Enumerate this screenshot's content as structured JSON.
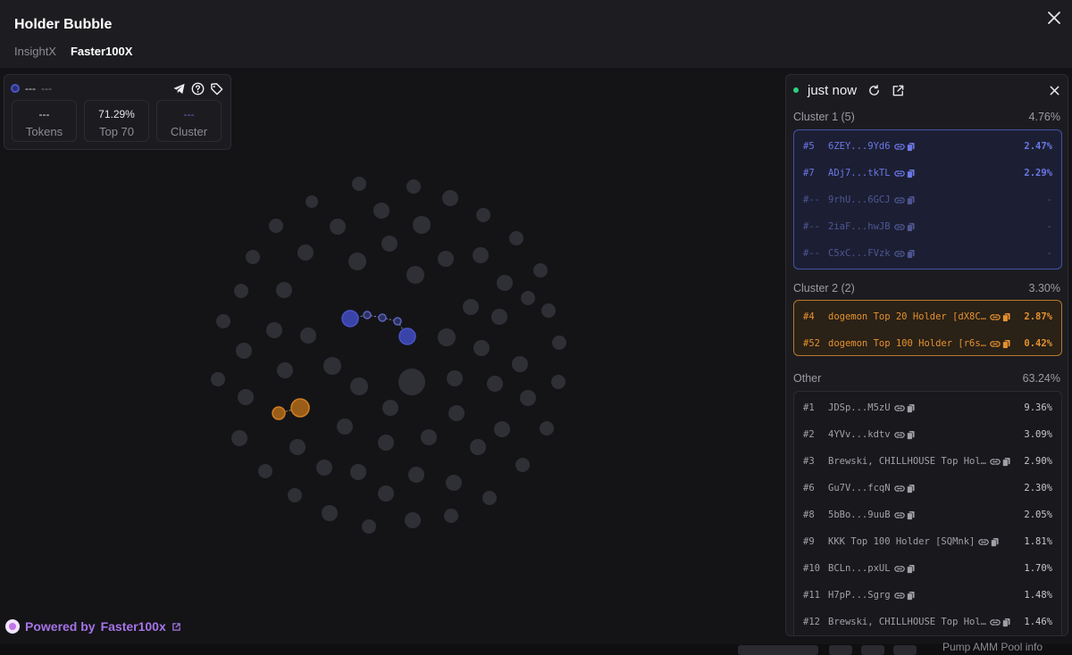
{
  "header": {
    "title": "Holder Bubble",
    "tabs": [
      {
        "label": "InsightX",
        "active": false
      },
      {
        "label": "Faster100X",
        "active": true
      }
    ],
    "close_icon": "close-icon"
  },
  "info_card": {
    "name": "---",
    "symbol": "---",
    "icons": [
      "telegram-icon",
      "help-icon",
      "tag-icon"
    ],
    "stats": [
      {
        "value": "---",
        "label": "Tokens"
      },
      {
        "value": "71.29%",
        "label": "Top 70"
      },
      {
        "value": "---",
        "label": "Cluster"
      }
    ]
  },
  "powered": {
    "prefix": "Powered by",
    "brand": "Faster100x",
    "link_icon": "external-link-icon"
  },
  "panel": {
    "status": "just now",
    "icons": [
      "refresh-icon",
      "external-link-icon",
      "close-icon"
    ],
    "cluster1": {
      "label": "Cluster 1 (5)",
      "percent": "4.76%",
      "rows": [
        {
          "rank": "#5",
          "name": "6ZEY...9Yd6",
          "percent": "2.47%",
          "dim": false
        },
        {
          "rank": "#7",
          "name": "ADj7...tkTL",
          "percent": "2.29%",
          "dim": false
        },
        {
          "rank": "#--",
          "name": "9rhU...6GCJ",
          "percent": "-",
          "dim": true
        },
        {
          "rank": "#--",
          "name": "2iaF...hwJB",
          "percent": "-",
          "dim": true
        },
        {
          "rank": "#--",
          "name": "C5xC...FVzk",
          "percent": "-",
          "dim": true
        }
      ]
    },
    "cluster2": {
      "label": "Cluster 2 (2)",
      "percent": "3.30%",
      "rows": [
        {
          "rank": "#4",
          "name": "dogemon Top 20 Holder [dX8C…",
          "percent": "2.87%"
        },
        {
          "rank": "#52",
          "name": "dogemon Top 100 Holder [r6s…",
          "percent": "0.42%"
        }
      ]
    },
    "other": {
      "label": "Other",
      "percent": "63.24%",
      "rows": [
        {
          "rank": "#1",
          "name": "JDSp...M5zU",
          "percent": "9.36%"
        },
        {
          "rank": "#2",
          "name": "4YVv...kdtv",
          "percent": "3.09%"
        },
        {
          "rank": "#3",
          "name": "Brewski, CHILLHOUSE Top Hol…",
          "percent": "2.90%"
        },
        {
          "rank": "#6",
          "name": "Gu7V...fcqN",
          "percent": "2.30%"
        },
        {
          "rank": "#8",
          "name": "5bBo...9uuB",
          "percent": "2.05%"
        },
        {
          "rank": "#9",
          "name": "KKK Top 100 Holder [SQMnk]",
          "percent": "1.81%"
        },
        {
          "rank": "#10",
          "name": "BCLn...pxUL",
          "percent": "1.70%"
        },
        {
          "rank": "#11",
          "name": "H7pP...Sgrg",
          "percent": "1.48%"
        },
        {
          "rank": "#12",
          "name": "Brewski, CHILLHOUSE Top Hol…",
          "percent": "1.46%"
        }
      ]
    }
  },
  "taskbar": {
    "text": "Pump AMM Pool info"
  },
  "colors": {
    "background": "#141417",
    "header": "#1d1d21",
    "cluster1": "#4a55c8",
    "cluster2": "#d07f24",
    "bubble": "#2f3036",
    "live": "#2ecf7d",
    "brand": "#a674e6"
  }
}
